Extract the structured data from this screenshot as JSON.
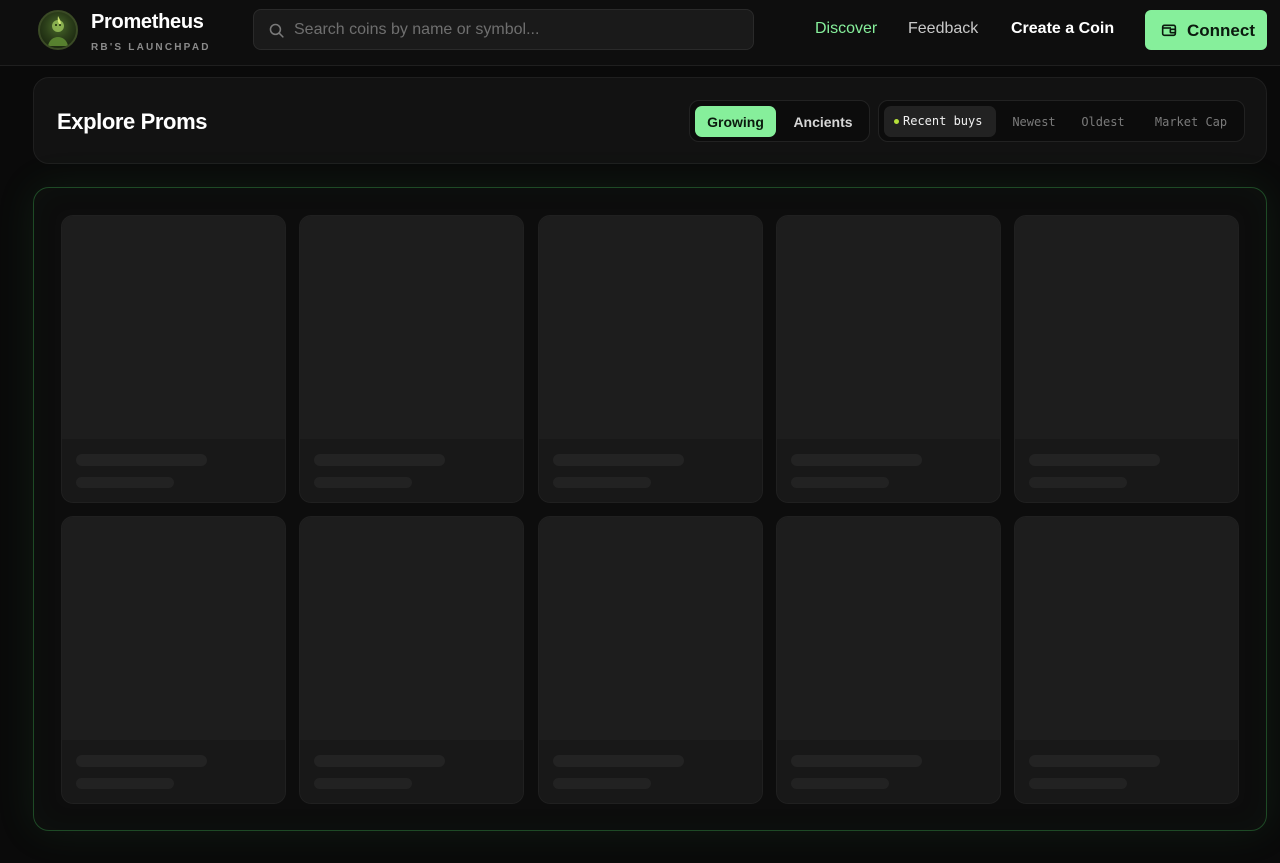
{
  "brand": {
    "name": "Prometheus",
    "tagline": "RB'S LAUNCHPAD",
    "logo_icon": "prometheus-logo-icon"
  },
  "search": {
    "placeholder": "Search coins by name or symbol...",
    "value": "",
    "icon": "search-icon"
  },
  "nav": {
    "discover": "Discover",
    "feedback": "Feedback",
    "create": "Create a Coin",
    "connect": "Connect",
    "connect_icon": "wallet-icon"
  },
  "explore": {
    "title": "Explore Proms",
    "modes": [
      {
        "label": "Growing",
        "active": true
      },
      {
        "label": "Ancients",
        "active": false
      }
    ],
    "sorts": [
      {
        "label": "Recent buys",
        "active": true
      },
      {
        "label": "Newest",
        "active": false
      },
      {
        "label": "Oldest",
        "active": false
      },
      {
        "label": "Market Cap",
        "active": false
      }
    ]
  },
  "grid": {
    "loading": true,
    "skeleton_count": 10
  },
  "colors": {
    "accent": "#86ef9b",
    "background": "#0a0a0a",
    "panel_border": "#1e4a26",
    "live_dot": "#b5e03a"
  }
}
